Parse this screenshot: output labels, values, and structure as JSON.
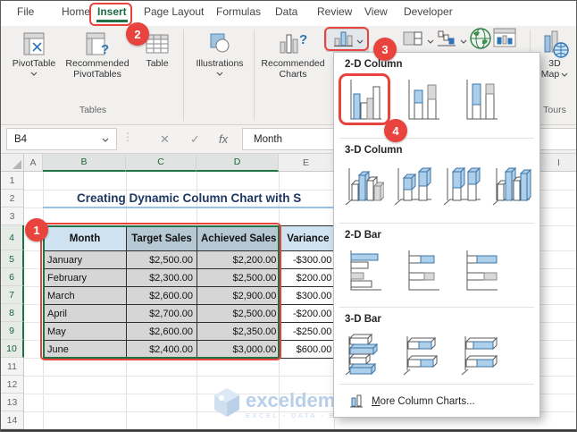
{
  "app": {
    "name": "Excel"
  },
  "tabs": {
    "items": [
      "File",
      "Home",
      "Insert",
      "Page Layout",
      "Formulas",
      "Data",
      "Review",
      "View",
      "Developer"
    ],
    "active": "Insert"
  },
  "ribbon": {
    "labels": {
      "pivottable": "PivotTable",
      "rec_pivottables_1": "Recommended",
      "rec_pivottables_2": "PivotTables",
      "table": "Table",
      "tables_group": "Tables",
      "illustrations": "Illustrations",
      "rec_charts_1": "Recommended",
      "rec_charts_2": "Charts",
      "threed": "3D",
      "map": "Map",
      "tours_group": "Tours"
    },
    "big_buttons": [
      {
        "name": "pivottable-button",
        "icon": "pivottable"
      },
      {
        "name": "recommended-pivottables-button",
        "icon": "recpivot"
      },
      {
        "name": "table-button",
        "icon": "tableicon"
      },
      {
        "name": "illustrations-button",
        "icon": "illustrations"
      },
      {
        "name": "recommended-charts-button",
        "icon": "recchart"
      },
      {
        "name": "3d-map-button",
        "icon": "map3d"
      }
    ],
    "chart_buttons": [
      {
        "name": "insert-column-chart-button",
        "icon": "miniColumn",
        "chevron": true,
        "highlighted": true
      },
      {
        "name": "insert-hierarchy-chart-button",
        "icon": "treemap",
        "chevron": true
      },
      {
        "name": "insert-waterfall-chart-button",
        "icon": "waterfall",
        "chevron": true
      },
      {
        "name": "insert-map-chart-button",
        "icon": "globe",
        "chevron": false
      },
      {
        "name": "pivotchart-button",
        "icon": "pivotChart",
        "chevron": false
      }
    ]
  },
  "formula_bar": {
    "name_box": "B4",
    "cancel": "✕",
    "enter": "✓",
    "fx": "fx",
    "value": "Month"
  },
  "sheet": {
    "columns": [
      {
        "label": "A",
        "selected": false
      },
      {
        "label": "B",
        "selected": true
      },
      {
        "label": "C",
        "selected": true
      },
      {
        "label": "D",
        "selected": true
      },
      {
        "label": "E",
        "selected": false
      },
      {
        "label": "I",
        "selected": false
      }
    ],
    "rows": [
      "1",
      "2",
      "3",
      "4",
      "5",
      "6",
      "7",
      "8",
      "9",
      "10",
      "11",
      "12",
      "13",
      "14"
    ],
    "selected_rows": [
      "4",
      "5",
      "6",
      "7",
      "8",
      "9",
      "10"
    ]
  },
  "title": {
    "text": "Creating Dynamic Column Chart with S"
  },
  "table": {
    "headers": [
      "Month",
      "Target Sales",
      "Achieved Sales",
      "Variance"
    ],
    "rows": [
      [
        "January",
        "$2,500.00",
        "$2,200.00",
        "-$300.00"
      ],
      [
        "February",
        "$2,300.00",
        "$2,500.00",
        "$200.00"
      ],
      [
        "March",
        "$2,600.00",
        "$2,900.00",
        "$300.00"
      ],
      [
        "April",
        "$2,700.00",
        "$2,500.00",
        "-$200.00"
      ],
      [
        "May",
        "$2,600.00",
        "$2,350.00",
        "-$250.00"
      ],
      [
        "June",
        "$2,400.00",
        "$3,000.00",
        "$600.00"
      ]
    ],
    "active_cell": "B4"
  },
  "dropdown": {
    "sections": [
      {
        "title": "2-D Column",
        "items": [
          {
            "name": "clustered-column",
            "icon": "colClustered",
            "highlighted": true
          },
          {
            "name": "stacked-column",
            "icon": "colStacked",
            "highlighted": false
          },
          {
            "name": "100-percent-stacked-column",
            "icon": "col100",
            "highlighted": false
          }
        ]
      },
      {
        "title": "3-D Column",
        "items": [
          {
            "name": "3d-clustered-column",
            "icon": "col3dClustered",
            "highlighted": false
          },
          {
            "name": "3d-stacked-column",
            "icon": "col3dStacked",
            "highlighted": false
          },
          {
            "name": "3d-100-percent-stacked-column",
            "icon": "col3d100",
            "highlighted": false
          },
          {
            "name": "3d-column",
            "icon": "col3dPlain",
            "highlighted": false
          }
        ]
      },
      {
        "title": "2-D Bar",
        "items": [
          {
            "name": "clustered-bar",
            "icon": "barClustered",
            "highlighted": false
          },
          {
            "name": "stacked-bar",
            "icon": "barStacked",
            "highlighted": false
          },
          {
            "name": "100-percent-stacked-bar",
            "icon": "bar100",
            "highlighted": false
          }
        ]
      },
      {
        "title": "3-D Bar",
        "items": [
          {
            "name": "3d-clustered-bar",
            "icon": "bar3dClustered",
            "highlighted": false
          },
          {
            "name": "3d-stacked-bar",
            "icon": "bar3dStacked",
            "highlighted": false
          },
          {
            "name": "3d-100-percent-stacked-bar",
            "icon": "bar3d100",
            "highlighted": false
          }
        ]
      }
    ],
    "more_label": "More Column Charts...",
    "more_icon": "moreColumns"
  },
  "watermark": {
    "brand": "exceldemy",
    "tagline": "EXCEL - DATA - B"
  },
  "annotations": {
    "color": "#e8433c",
    "badges": [
      "1",
      "2",
      "3",
      "4"
    ]
  },
  "colors": {
    "excel_green": "#217346",
    "annotation_red": "#e8433c",
    "header_fill_blue": "#cfe3f1",
    "selected_header_fill": "#b7c8d5",
    "selected_cell_fill": "#d6d6d6",
    "title_navy": "#1f3864",
    "chart_icon_blue": "#aecfe9",
    "chart_icon_gray": "#d9d9d9"
  }
}
